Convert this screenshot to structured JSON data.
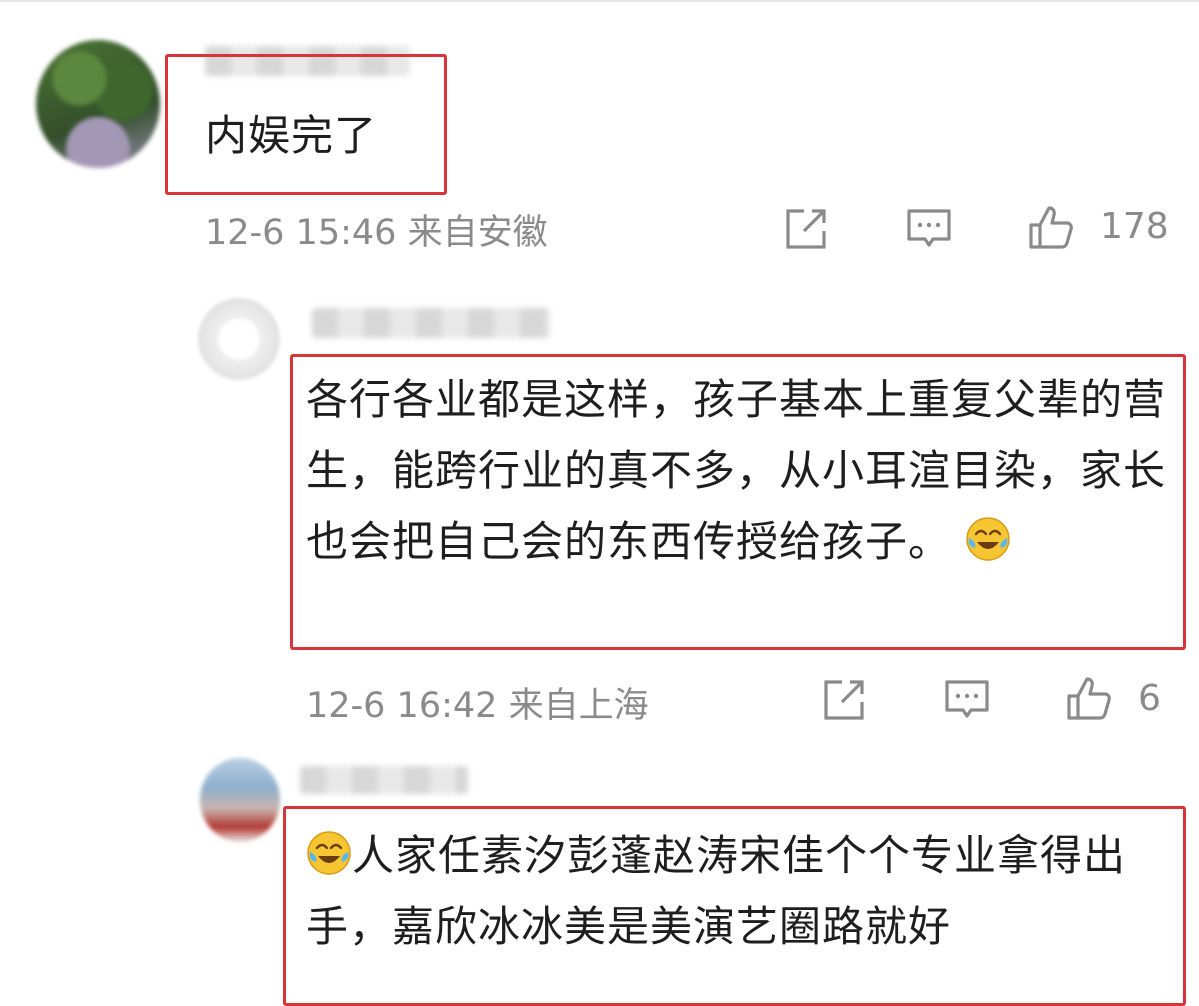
{
  "comments": [
    {
      "text": "内娱完了",
      "time": "12-6 15:46",
      "location": "来自安徽",
      "likes": "178"
    },
    {
      "text": "各行各业都是这样，孩子基本上重复父辈的营生，能跨行业的真不多，从小耳渲目染，家长也会把自己会的东西传授给孩子。",
      "time": "12-6 16:42",
      "location": "来自上海",
      "likes": "6"
    },
    {
      "text_after_emoji": "人家任素汐彭蓬赵涛宋佳个个专业拿得出手，嘉欣冰冰美是美演艺圈路就好"
    }
  ],
  "icons": {
    "share": "share-icon",
    "comment": "comment-icon",
    "like": "like-icon",
    "emoji": "laugh-cry-emoji"
  },
  "colors": {
    "highlight": "#d9343a",
    "meta": "#8a8a8a"
  }
}
